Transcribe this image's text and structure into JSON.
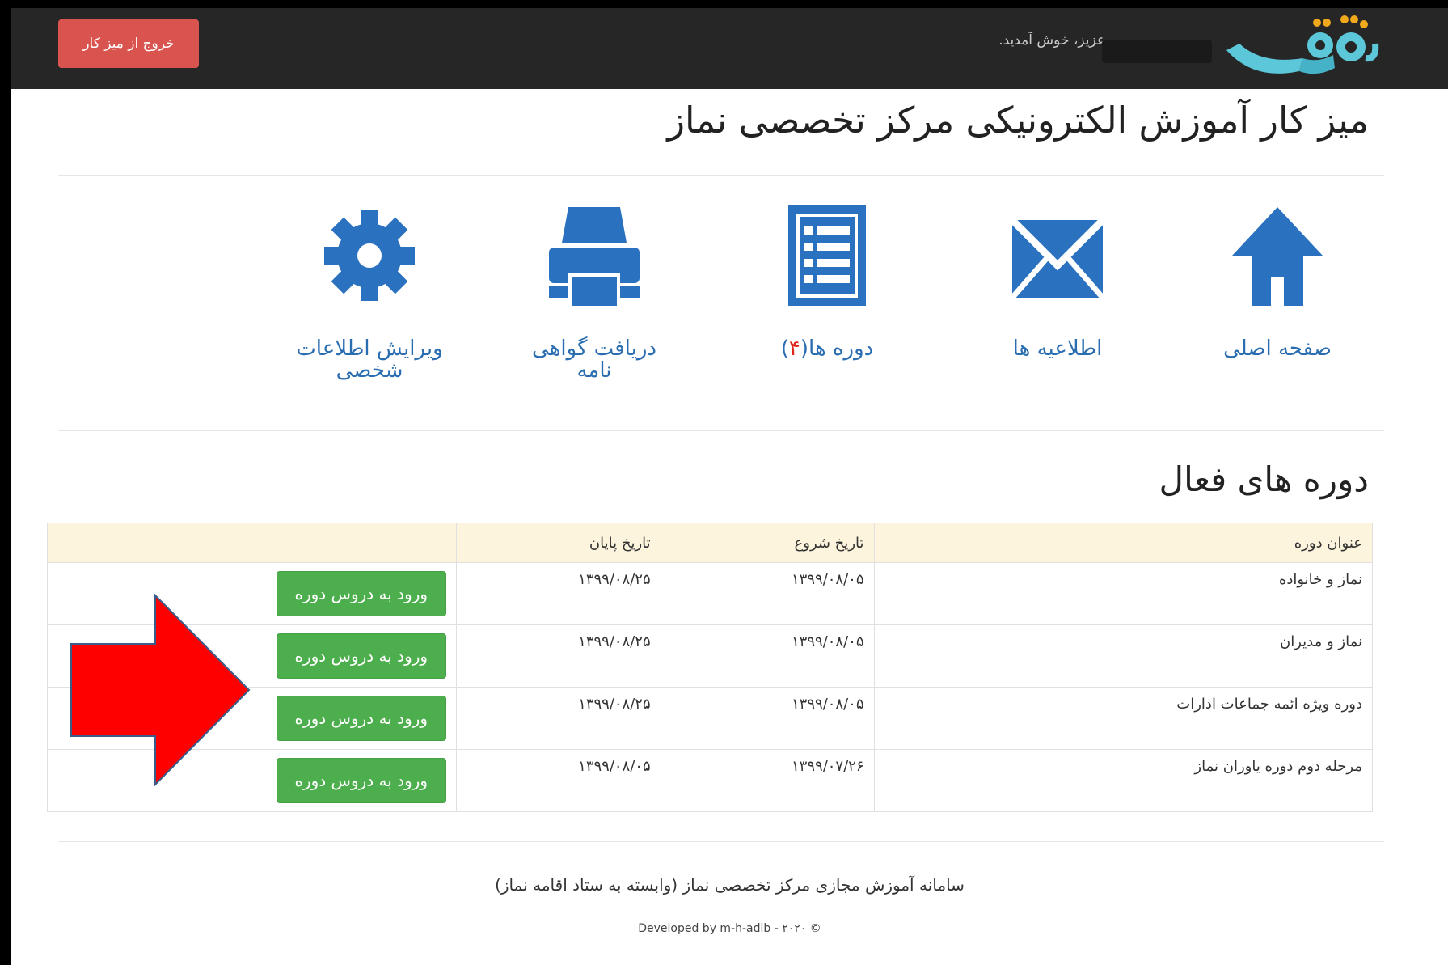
{
  "topbar": {
    "logout_label": "خروج از میز کار",
    "welcome_text": "عزیز، خوش آمدید.",
    "logo": "site-logo"
  },
  "page": {
    "title": "میز کار آموزش الکترونیکی مرکز تخصصی نماز"
  },
  "nav": {
    "items": [
      {
        "label": "صفحه اصلی",
        "icon": "home-icon"
      },
      {
        "label": "اطلاعیه ها",
        "icon": "envelope-icon"
      },
      {
        "label": "دوره ها(",
        "badge": "۴",
        "label_end": ")",
        "icon": "list-icon"
      },
      {
        "label": "دریافت گواهی نامه",
        "icon": "printer-icon"
      },
      {
        "label": "ویرایش اطلاعات شخصی",
        "icon": "gear-icon"
      }
    ]
  },
  "section": {
    "title": "دوره های فعال"
  },
  "table": {
    "headers": [
      "عنوان دوره",
      "تاریخ شروع",
      "تاریخ پایان",
      ""
    ],
    "rows": [
      {
        "title": "نماز و خانواده",
        "start": "۱۳۹۹/۰۸/۰۵",
        "end": "۱۳۹۹/۰۸/۲۵",
        "action": "ورود به دروس دوره"
      },
      {
        "title": "نماز و مدیران",
        "start": "۱۳۹۹/۰۸/۰۵",
        "end": "۱۳۹۹/۰۸/۲۵",
        "action": "ورود به دروس دوره"
      },
      {
        "title": "دوره ویژه ائمه جماعات ادارات",
        "start": "۱۳۹۹/۰۸/۰۵",
        "end": "۱۳۹۹/۰۸/۲۵",
        "action": "ورود به دروس دوره"
      },
      {
        "title": "مرحله دوم دوره یاوران نماز",
        "start": "۱۳۹۹/۰۷/۲۶",
        "end": "۱۳۹۹/۰۸/۰۵",
        "action": "ورود به دروس دوره"
      }
    ]
  },
  "footer": {
    "text": "سامانه آموزش مجازی مرکز تخصصی نماز (وابسته به ستاد اقامه نماز)",
    "developer": "Developed by m-h-adib - ۲۰۲۰ ©"
  },
  "colors": {
    "topbar": "#262626",
    "logout": "#d9534f",
    "link": "#2a6db0",
    "enter_button": "#4cae4c",
    "table_header": "#fcf4dd",
    "arrow": "#ff0000"
  }
}
